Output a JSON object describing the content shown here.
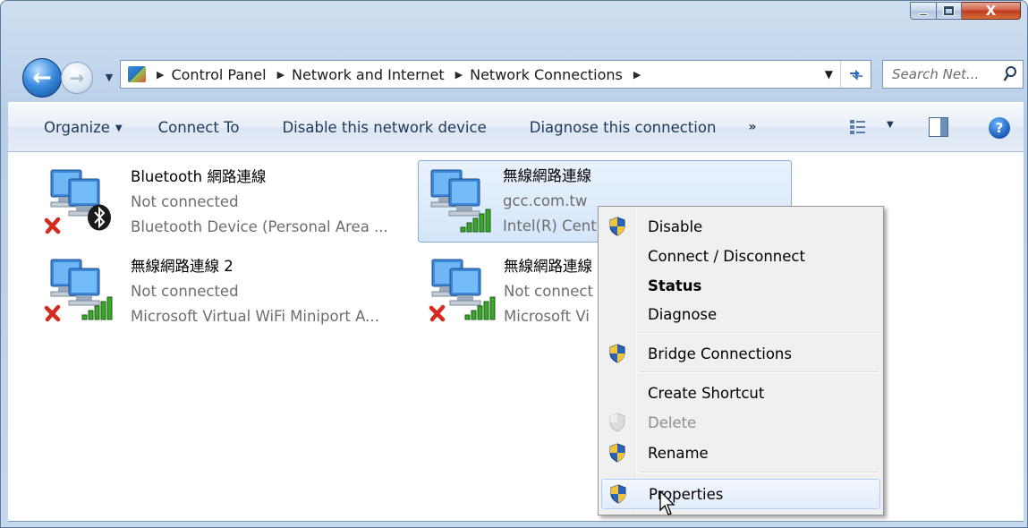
{
  "window": {
    "minimize_glyph": "—",
    "maximize_glyph": "☐",
    "close_glyph": "X"
  },
  "nav": {
    "back_glyph": "←",
    "forward_glyph": "→",
    "breadcrumbs": [
      "Control Panel",
      "Network and Internet",
      "Network Connections"
    ],
    "breadcrumb_separator": "▶",
    "search_placeholder": "Search Net..."
  },
  "toolbar": {
    "organize_label": "Organize",
    "connect_to_label": "Connect To",
    "disable_label": "Disable this network device",
    "diagnose_label": "Diagnose this connection",
    "more_glyph": "»",
    "help_glyph": "?"
  },
  "connections": [
    {
      "name": "Bluetooth 網路連線",
      "status": "Not connected",
      "device": "Bluetooth Device (Personal Area ...",
      "badge": "bluetooth-icon",
      "disconnected": true
    },
    {
      "name": "無線網路連線",
      "status": "gcc.com.tw",
      "device": "Intel(R) Cent",
      "badge": "signal-bars-icon",
      "disconnected": false,
      "selected": true
    },
    {
      "name": "無線網路連線 2",
      "status": "Not connected",
      "device": "Microsoft Virtual WiFi Miniport A...",
      "badge": "signal-bars-icon",
      "disconnected": true
    },
    {
      "name": "無線網路連線",
      "status": "Not connect",
      "device": "Microsoft Vi",
      "badge": "signal-bars-icon",
      "disconnected": true
    }
  ],
  "context_menu": {
    "items": [
      {
        "label": "Disable",
        "shield": true
      },
      {
        "label": "Connect / Disconnect",
        "shield": false
      },
      {
        "label": "Status",
        "shield": false,
        "bold": true
      },
      {
        "label": "Diagnose",
        "shield": false
      },
      {
        "label": "Bridge Connections",
        "shield": true
      },
      {
        "label": "Create Shortcut",
        "shield": false
      },
      {
        "label": "Delete",
        "shield": true,
        "disabled": true
      },
      {
        "label": "Rename",
        "shield": true
      },
      {
        "label": "Properties",
        "shield": true,
        "hover": true
      }
    ]
  },
  "colors": {
    "accent": "#2a6bb8",
    "selection_bg": "#d4e6fa",
    "selection_border": "#84acdd",
    "disconnected_x": "#d52b1e",
    "signal_green": "#3aa62a"
  }
}
